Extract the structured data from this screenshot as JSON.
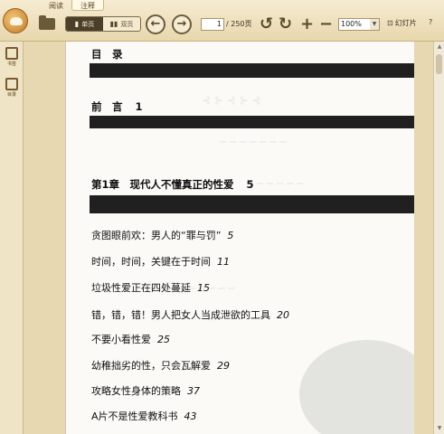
{
  "menu": {
    "tabs": [
      {
        "label": "阅读"
      },
      {
        "label": "注释"
      }
    ]
  },
  "toolbar": {
    "open_icon": "folder-icon",
    "single_page": "单页",
    "double_page": "双页",
    "prev_icon": "arrow-left-icon",
    "next_icon": "arrow-right-icon",
    "current_page": "1",
    "total_pages": "/ 250页",
    "rotate_left_icon": "rotate-left-icon",
    "rotate_right_icon": "rotate-right-icon",
    "zoom_in_icon": "plus-icon",
    "zoom_out_icon": "minus-icon",
    "zoom_value": "100%",
    "slideshow": "幻灯片",
    "help": "?"
  },
  "sidebar": {
    "items": [
      {
        "label": "书签",
        "icon": "bookmark-icon"
      },
      {
        "label": "目录",
        "icon": "toc-icon"
      }
    ]
  },
  "document": {
    "toc_title": "目　录",
    "preface": {
      "text": "前　言",
      "page": "1"
    },
    "chapter": {
      "text": "第1章　现代人不懂真正的性爱",
      "page": "5"
    },
    "entries": [
      {
        "text": "贪图眼前欢：男人的“罪与罚”",
        "page": "5"
      },
      {
        "text": "时间，时间，关键在于时间",
        "page": "11"
      },
      {
        "text": "垃圾性爱正在四处蔓延",
        "page": "15"
      },
      {
        "text": "错，错，错！男人把女人当成泄欲的工具",
        "page": "20"
      },
      {
        "text": "不要小看性爱",
        "page": "25"
      },
      {
        "text": "幼稚拙劣的性，只会瓦解爱",
        "page": "29"
      },
      {
        "text": "攻略女性身体的策略",
        "page": "37"
      },
      {
        "text": "A片不是性爱教科书",
        "page": "43"
      }
    ]
  }
}
